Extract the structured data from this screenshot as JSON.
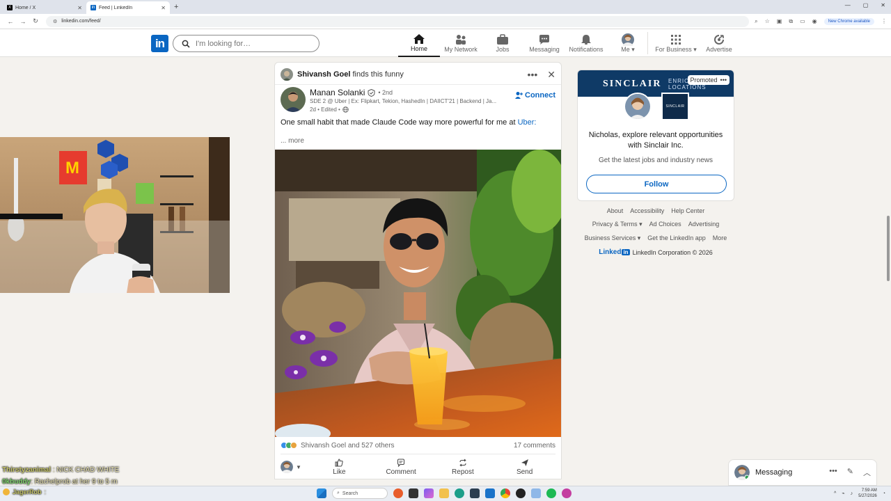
{
  "browser": {
    "tabs": [
      {
        "title": "Home / X",
        "favicon": "x-logo",
        "active": false
      },
      {
        "title": "Feed | LinkedIn",
        "favicon": "linkedin-logo",
        "active": true
      }
    ],
    "url": "linkedin.com/feed/",
    "update_badge": "New Chrome available"
  },
  "header": {
    "search_placeholder": "I'm looking for…",
    "nav": [
      {
        "label": "Home",
        "icon": "home-icon",
        "active": true
      },
      {
        "label": "My Network",
        "icon": "network-icon",
        "active": false
      },
      {
        "label": "Jobs",
        "icon": "briefcase-icon",
        "active": false
      },
      {
        "label": "Messaging",
        "icon": "chat-icon",
        "active": false
      },
      {
        "label": "Notifications",
        "icon": "bell-icon",
        "active": false
      },
      {
        "label": "Me",
        "icon": "avatar",
        "active": false
      },
      {
        "label": "For Business",
        "icon": "grid-icon",
        "active": false
      },
      {
        "label": "Advertise",
        "icon": "advertise-icon",
        "active": false
      }
    ]
  },
  "post": {
    "context_user": "Shivansh Goel",
    "context_action": "finds this funny",
    "author_name": "Manan Solanki",
    "degree": "• 2nd",
    "headline": "SDE 2 @ Uber | Ex: Flipkart, Tekion, HashedIn | DAIICT'21 | Backend | Ja...",
    "meta": "2d • Edited •",
    "connect_label": "Connect",
    "text": "One small habit that made Claude Code way more powerful for me at ",
    "mention": "Uber:",
    "more_label": "... more",
    "reactions_text": "Shivansh Goel and 527 others",
    "comments_text": "17 comments",
    "actions": [
      {
        "label": "Like",
        "icon": "thumbs-up-icon"
      },
      {
        "label": "Comment",
        "icon": "comment-icon"
      },
      {
        "label": "Repost",
        "icon": "repost-icon"
      },
      {
        "label": "Send",
        "icon": "send-icon"
      }
    ]
  },
  "ad": {
    "brand": "SINCLAIR",
    "brand_secondary": "ENRICHED LOCATIONS",
    "logo_text": "SINCLAIR",
    "promoted_label": "Promoted",
    "title": "Nicholas, explore relevant opportunities with Sinclair Inc.",
    "subtitle": "Get the latest jobs and industry news",
    "follow_label": "Follow"
  },
  "footer": {
    "row1": [
      "About",
      "Accessibility",
      "Help Center"
    ],
    "row2": [
      "Privacy & Terms",
      "Ad Choices",
      "Advertising"
    ],
    "row3": [
      "Business Services",
      "Get the LinkedIn app",
      "More"
    ],
    "copyright_brand": "Linked",
    "copyright_text": "LinkedIn Corporation © 2026"
  },
  "messaging": {
    "label": "Messaging"
  },
  "chat": [
    {
      "user": "Thirstyzanimal",
      "text": ": NICK CHAD WHITE"
    },
    {
      "user": "0kbuddy",
      "text": ": Rachelprob at her 9 to 5 rn"
    },
    {
      "user": "JagerRob",
      "text": ":"
    }
  ],
  "taskbar": {
    "search_label": "Search",
    "time": "7:59 AM",
    "date": "5/27/2026"
  },
  "colors": {
    "linkedin_blue": "#0a66c2",
    "page_bg": "#f4f2ee",
    "ad_banner": "#0f3a66"
  }
}
